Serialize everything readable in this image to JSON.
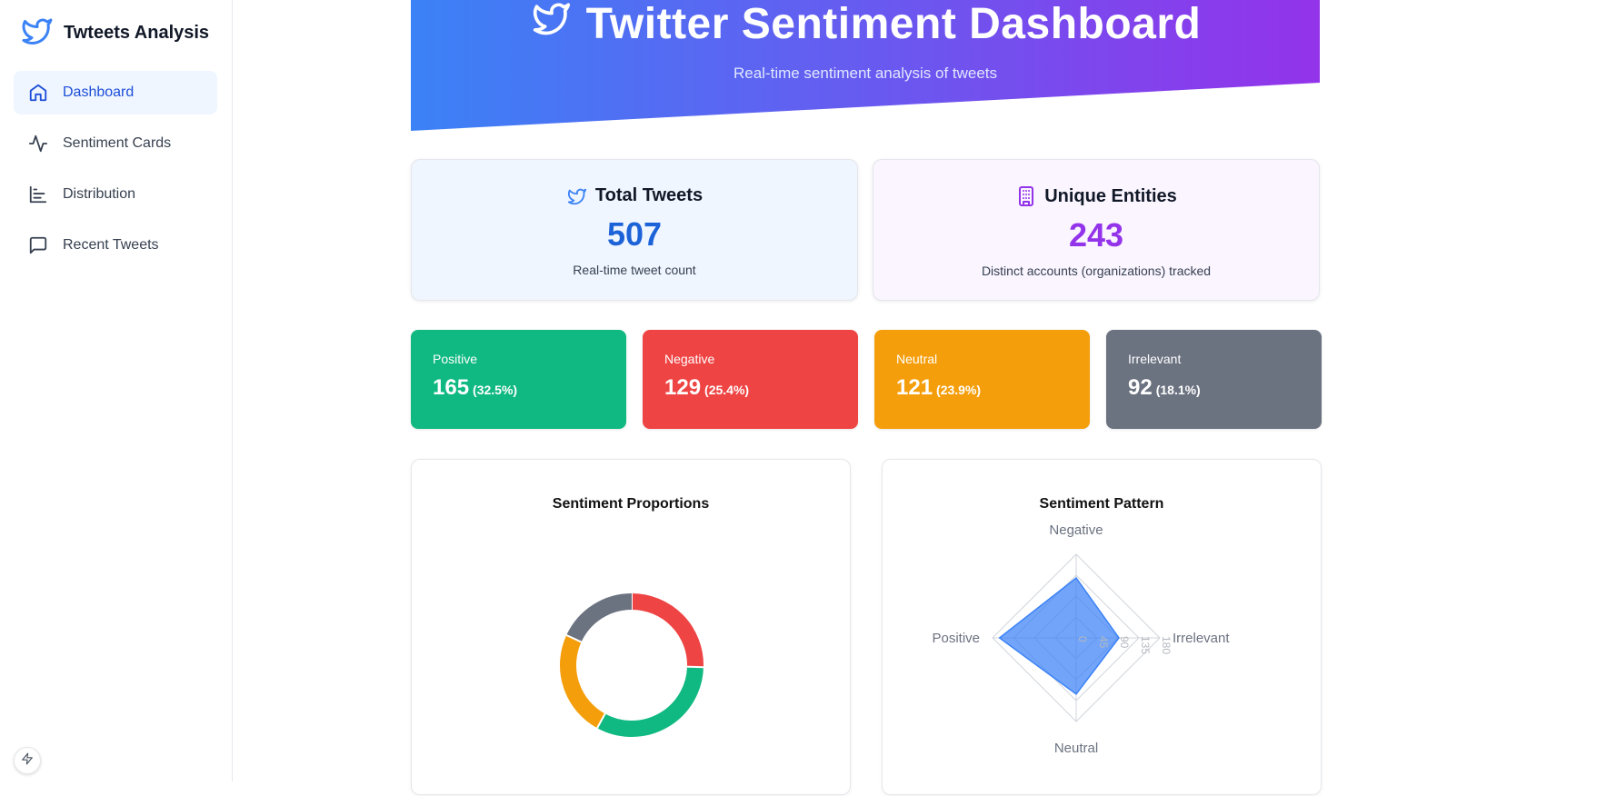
{
  "sidebar": {
    "brand": "Twteets Analysis",
    "items": [
      {
        "label": "Dashboard",
        "icon": "home-icon",
        "active": true
      },
      {
        "label": "Sentiment Cards",
        "icon": "activity-icon"
      },
      {
        "label": "Distribution",
        "icon": "bar-chart-icon"
      },
      {
        "label": "Recent Tweets",
        "icon": "message-square-icon"
      }
    ]
  },
  "hero": {
    "title": "Twitter Sentiment Dashboard",
    "subtitle": "Real-time sentiment analysis of tweets"
  },
  "stats": {
    "total": {
      "label": "Total Tweets",
      "value": "507",
      "desc": "Real-time tweet count"
    },
    "entities": {
      "label": "Unique Entities",
      "value": "243",
      "desc": "Distinct accounts (organizations) tracked"
    }
  },
  "sentiments": [
    {
      "label": "Positive",
      "count": "165",
      "pct": "(32.5%)",
      "color": "#10b981"
    },
    {
      "label": "Negative",
      "count": "129",
      "pct": "(25.4%)",
      "color": "#ef4444"
    },
    {
      "label": "Neutral",
      "count": "121",
      "pct": "(23.9%)",
      "color": "#f59e0b"
    },
    {
      "label": "Irrelevant",
      "count": "92",
      "pct": "(18.1%)",
      "color": "#6b7280"
    }
  ],
  "chart_data": [
    {
      "type": "pie",
      "title": "Sentiment Proportions",
      "categories": [
        "Negative",
        "Positive",
        "Neutral",
        "Irrelevant"
      ],
      "values": [
        129,
        165,
        121,
        92
      ],
      "colors": [
        "#ef4444",
        "#10b981",
        "#f59e0b",
        "#6b7280"
      ]
    },
    {
      "type": "radar",
      "title": "Sentiment Pattern",
      "categories": [
        "Negative",
        "Irrelevant",
        "Neutral",
        "Positive"
      ],
      "values": [
        129,
        92,
        121,
        165
      ],
      "ticks": [
        "0",
        "45",
        "90",
        "135",
        "180"
      ],
      "rmax": 180,
      "color": "#3b82f6"
    }
  ]
}
